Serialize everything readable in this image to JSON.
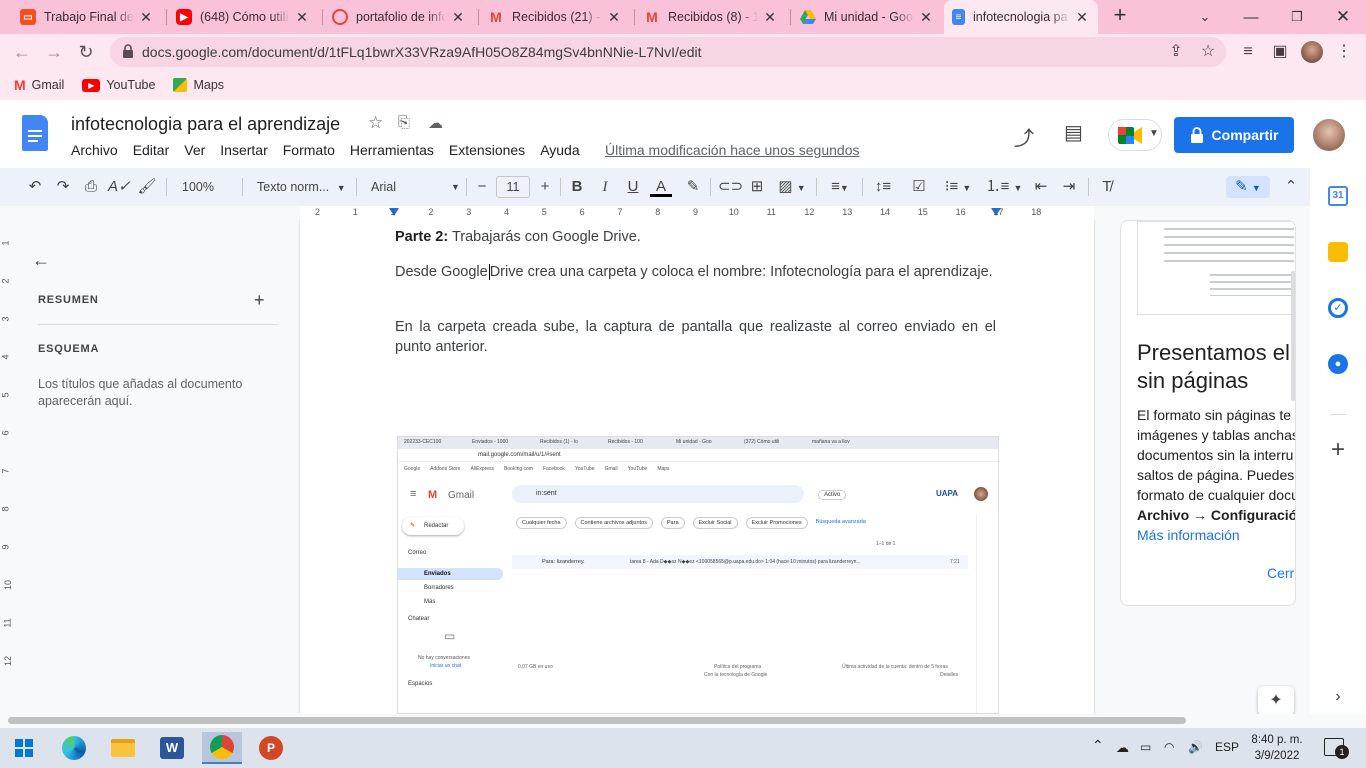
{
  "browser": {
    "tabs": [
      {
        "title": "Trabajo Final de I",
        "icon": "slides-icon",
        "color": "#f4511e"
      },
      {
        "title": "(648) Cómo utiliz",
        "icon": "youtube-icon",
        "color": "#ff0000"
      },
      {
        "title": "portafolio de info",
        "icon": "portfolio-icon",
        "color": "#ea4335"
      },
      {
        "title": "Recibidos (21) - l",
        "icon": "gmail-icon",
        "color": "#ea4335"
      },
      {
        "title": "Recibidos (8) - 10",
        "icon": "gmail-icon",
        "color": "#ea4335"
      },
      {
        "title": "Mi unidad - Goo",
        "icon": "drive-icon",
        "color": "#34a853"
      },
      {
        "title": "infotecnologia pa",
        "icon": "docs-icon",
        "color": "#4285f4"
      }
    ],
    "url": "docs.google.com/document/d/1tFLq1bwrX33VRza9AfH05O8Z84mgSv4bnNNie-L7NvI/edit",
    "bookmarks": [
      {
        "label": "Gmail",
        "icon": "gmail-icon"
      },
      {
        "label": "YouTube",
        "icon": "youtube-icon"
      },
      {
        "label": "Maps",
        "icon": "maps-icon"
      }
    ]
  },
  "doc": {
    "title": "infotecnologia para el aprendizaje",
    "menu": [
      "Archivo",
      "Editar",
      "Ver",
      "Insertar",
      "Formato",
      "Herramientas",
      "Extensiones",
      "Ayuda"
    ],
    "last_modified": "Última modificación hace unos segundos",
    "share_label": "Compartir"
  },
  "format_bar": {
    "zoom": "100%",
    "style": "Texto norm...",
    "font": "Arial",
    "size": "11"
  },
  "ruler": {
    "h_labels": [
      "2",
      "1",
      "1",
      "2",
      "3",
      "4",
      "5",
      "6",
      "7",
      "8",
      "9",
      "10",
      "11",
      "12",
      "13",
      "14",
      "15",
      "16",
      "17",
      "18"
    ],
    "v_labels": [
      "1",
      "2",
      "3",
      "4",
      "5",
      "6",
      "7",
      "8",
      "9",
      "10",
      "11",
      "12"
    ]
  },
  "outline": {
    "summary_label": "RESUMEN",
    "outline_label": "ESQUEMA",
    "empty_hint": "Los títulos que añadas al documento aparecerán aquí."
  },
  "document_body": {
    "p1_bold": "Parte 2:",
    "p1_rest": " Trabajarás con Google Drive.",
    "p2_a": "Desde Google",
    "p2_b": "Drive crea una carpeta y coloca el nombre: Infotecnología para el aprendizaje.",
    "p3": "En la carpeta creada sube, la captura de pantalla que realizaste al correo enviado en el punto anterior."
  },
  "screenshot_image": {
    "tabs": [
      "202233-CEC100",
      "Enviados - 1000",
      "Recibidos (1) - lo",
      "Recibidos - 100",
      "Mi unidad - Goo",
      "(372) Cómo utili",
      "mañana va a llov"
    ],
    "url": "mail.google.com/mail/u/1/#sent",
    "bookmarks": [
      "Google",
      "Addons Store",
      "AliExpress",
      "Booking.com",
      "Facebook",
      "YouTube",
      "Gmail",
      "YouTube",
      "Maps"
    ],
    "app_name": "Gmail",
    "search_value": "in:sent",
    "status": "Activo",
    "org": "UAPA",
    "compose": "Redactar",
    "section_mail": "Correo",
    "nav": [
      "Enviados",
      "Borradores",
      "Más"
    ],
    "section_chat": "Chatear",
    "no_chats": "No hay conversaciones",
    "start_chat": "Iniciar un chat",
    "section_spaces": "Espacios",
    "filters": [
      "Cualquier fecha",
      "Contiene archivos adjuntos",
      "Para",
      "Excluir Social",
      "Excluir Promociones",
      "Búsqueda avanzada"
    ],
    "pager": "1–1 de 1",
    "email_to": "Para: lizanderrey.",
    "email_snippet": "tarea 8 - Ada D◆◆az N◆◆ez <100058565@p.uapa.edu.do> 1:04 (hace 10 minutos) para lizanderreyn...",
    "email_time": "7:21",
    "storage": "0,07 GB en uso",
    "policy": "Política del programa",
    "powered": "Con la tecnología de Google",
    "activity": "Última actividad de la cuenta: dentro de 5 horas",
    "details": "Detalles"
  },
  "side_panel": {
    "heading_line1": "Presentamos el",
    "heading_line2": "sin páginas",
    "body_lines": [
      "El formato sin páginas te",
      "imágenes y tablas anchas",
      "documentos sin la interru",
      "saltos de página. Puedes",
      "formato de cualquier docu"
    ],
    "path_bold": "Archivo → Configuración",
    "more_info": "Más información",
    "close": "Cerr"
  },
  "taskbar": {
    "language": "ESP",
    "time": "8:40 p. m.",
    "date": "3/9/2022",
    "notifications": "1"
  }
}
